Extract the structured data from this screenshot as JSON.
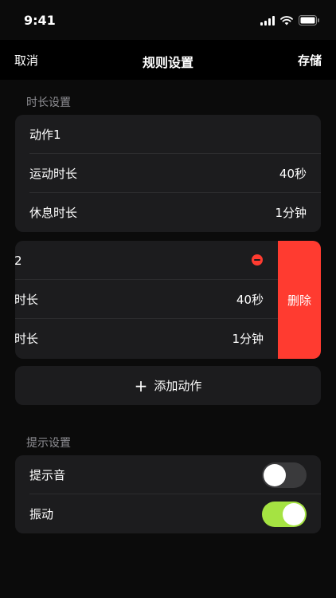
{
  "status": {
    "time": "9:41"
  },
  "nav": {
    "cancel": "取消",
    "title": "规则设置",
    "save": "存储"
  },
  "duration_section": {
    "title": "时长设置",
    "action1": {
      "name": "动作1",
      "exercise_label": "运动时长",
      "exercise_value": "40秒",
      "rest_label": "休息时长",
      "rest_value": "1分钟"
    },
    "action2": {
      "name": "2",
      "exercise_label": "时长",
      "exercise_value": "40秒",
      "rest_label": "时长",
      "rest_value": "1分钟",
      "delete_label": "删除"
    },
    "add_action_label": "添加动作"
  },
  "hint_section": {
    "title": "提示设置",
    "sound": {
      "label": "提示音",
      "on": false
    },
    "vibration": {
      "label": "振动",
      "on": true
    }
  },
  "colors": {
    "accent_toggle": "#a5e342",
    "delete": "#ff3b30"
  }
}
